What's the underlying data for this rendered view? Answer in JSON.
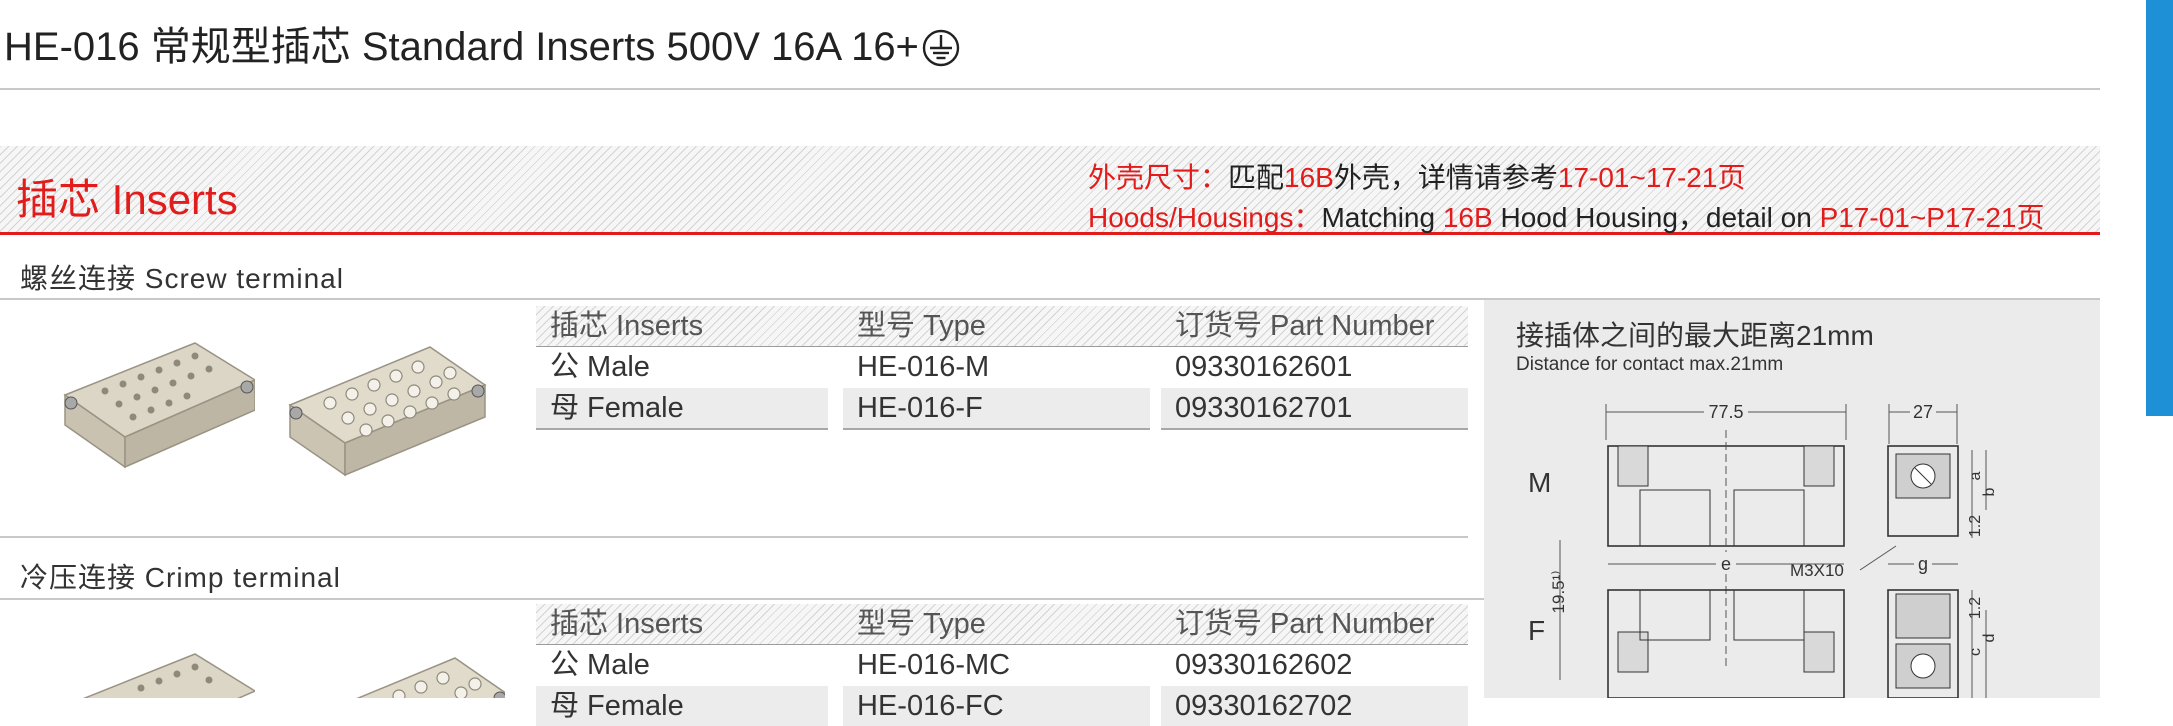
{
  "header": {
    "title": "HE-016 常规型插芯 Standard Inserts   500V 16A 16+",
    "earth_symbol": "protective-earth-icon"
  },
  "inserts_section": {
    "title": "插芯 Inserts",
    "hoods_cn": {
      "label": "外壳尺寸：",
      "text1": "匹配",
      "model": "16B",
      "text2": "外壳，详情请参考",
      "pages": "17-01~17-21",
      "text3": "页"
    },
    "hoods_en": {
      "label": "Hoods/Housings：",
      "text1": "Matching ",
      "model": "16B",
      "text2": " Hood Housing，detail on ",
      "pages": "P17-01~P17-21",
      "text3": "页"
    }
  },
  "screw_terminal": {
    "label": "螺丝连接 Screw terminal",
    "headers": [
      "插芯 Inserts",
      "型号 Type",
      "订货号 Part Number"
    ],
    "rows": [
      [
        "公 Male",
        "HE-016-M",
        "09330162601"
      ],
      [
        "母 Female",
        "HE-016-F",
        "09330162701"
      ]
    ]
  },
  "crimp_terminal": {
    "label": "冷压连接 Crimp terminal",
    "headers": [
      "插芯 Inserts",
      "型号 Type",
      "订货号 Part Number"
    ],
    "rows": [
      [
        "公 Male",
        "HE-016-MC",
        "09330162602"
      ],
      [
        "母 Female",
        "HE-016-FC",
        "09330162702"
      ]
    ]
  },
  "diagram": {
    "title": "接插体之间的最大距离21mm",
    "subtitle": "Distance for contact max.21mm",
    "labels": {
      "m": "M",
      "f": "F",
      "dim_77_5": "77.5",
      "dim_27": "27",
      "dim_e": "e",
      "dim_g": "g",
      "dim_a": "a",
      "dim_b": "b",
      "dim_c": "c",
      "dim_d": "d",
      "dim_1_2_top": "1.2",
      "dim_1_2_bottom": "1.2",
      "dim_19_5": "19.5¹⁾",
      "screw": "M3X10"
    }
  },
  "colors": {
    "accent_red": "#e21b1b",
    "blue_tab": "#1e90d6",
    "diagram_bg": "#ebebeb",
    "rule_gray": "#c8c8c8"
  }
}
